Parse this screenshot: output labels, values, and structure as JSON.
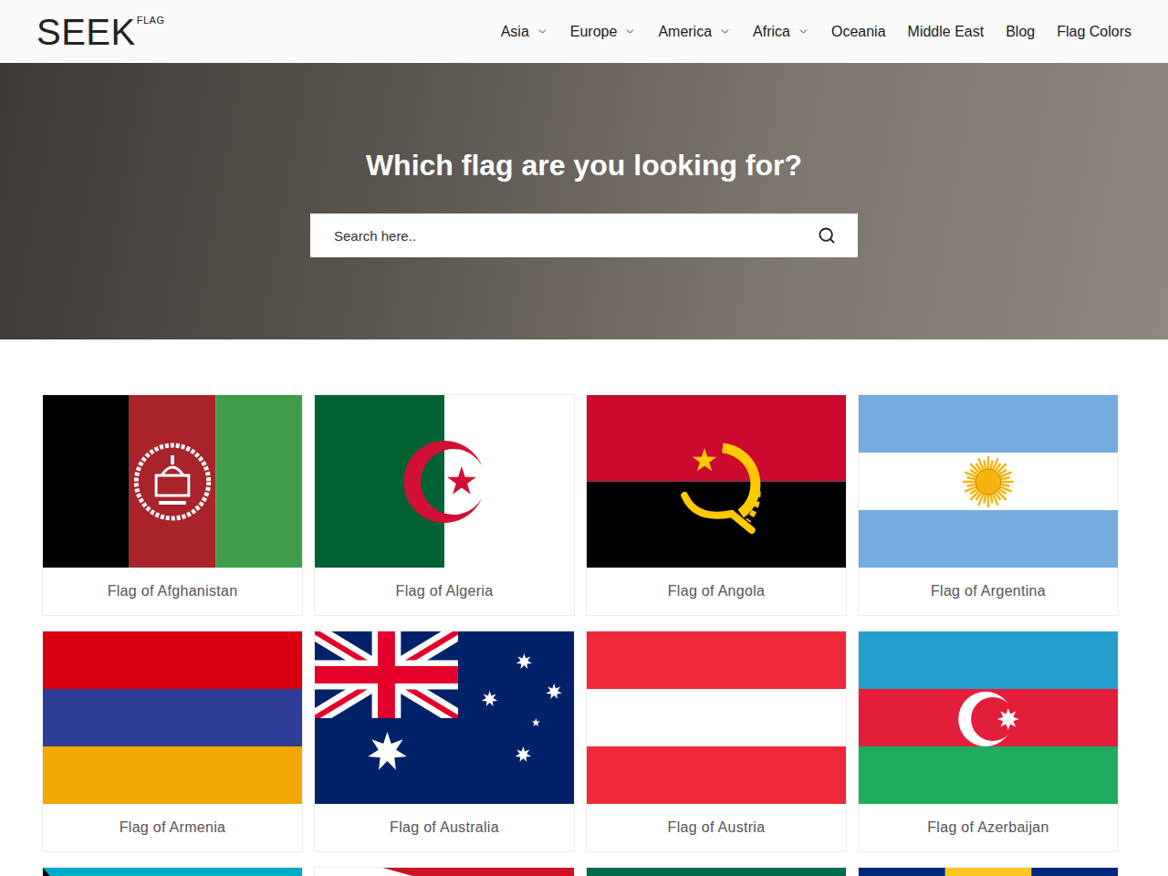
{
  "header": {
    "logo": {
      "word": "SEEK",
      "tag": "FLAG"
    },
    "nav": [
      {
        "label": "Asia",
        "has_dropdown": true
      },
      {
        "label": "Europe",
        "has_dropdown": true
      },
      {
        "label": "America",
        "has_dropdown": true
      },
      {
        "label": "Africa",
        "has_dropdown": true
      },
      {
        "label": "Oceania",
        "has_dropdown": false
      },
      {
        "label": "Middle East",
        "has_dropdown": false
      },
      {
        "label": "Blog",
        "has_dropdown": false
      },
      {
        "label": "Flag Colors",
        "has_dropdown": false
      }
    ]
  },
  "hero": {
    "title": "Which flag are you looking for?",
    "search": {
      "placeholder": "Search here.."
    }
  },
  "flags": [
    {
      "label": "Flag of Afghanistan",
      "kind": "afghanistan"
    },
    {
      "label": "Flag of Algeria",
      "kind": "algeria"
    },
    {
      "label": "Flag of Angola",
      "kind": "angola"
    },
    {
      "label": "Flag of Argentina",
      "kind": "argentina"
    },
    {
      "label": "Flag of Armenia",
      "kind": "armenia"
    },
    {
      "label": "Flag of Australia",
      "kind": "australia"
    },
    {
      "label": "Flag of Austria",
      "kind": "austria"
    },
    {
      "label": "Flag of Azerbaijan",
      "kind": "azerbaijan"
    },
    {
      "kind": "bahamas"
    },
    {
      "kind": "bahrain"
    },
    {
      "kind": "bangladesh"
    },
    {
      "kind": "barbados"
    }
  ]
}
